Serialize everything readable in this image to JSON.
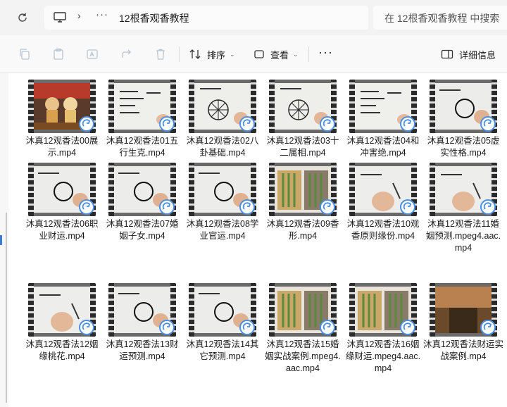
{
  "address": {
    "breadcrumb": "12根香观香教程",
    "search_placeholder": "在 12根香观香教程 中搜索"
  },
  "toolbar": {
    "sort_label": "排序",
    "view_label": "查看",
    "more_label": "···",
    "details_label": "详细信息"
  },
  "colors": {
    "accent": "#4b8fe2",
    "toolbar_bg": "#f9f9f9",
    "address_bg": "#f3f3f3"
  },
  "files": [
    {
      "name": "沐真12观香法00展示.mp4",
      "thumb": "altar"
    },
    {
      "name": "沐真12观香法01五行生克.mp4",
      "thumb": "writing"
    },
    {
      "name": "沐真12观香法02八卦基础.mp4",
      "thumb": "bagua"
    },
    {
      "name": "沐真12观香法03十二属相.mp4",
      "thumb": "bagua"
    },
    {
      "name": "沐真12观香法04和冲害绝.mp4",
      "thumb": "writing"
    },
    {
      "name": "沐真12观香法05虚实性格.mp4",
      "thumb": "circle"
    },
    {
      "name": "沐真12观香法06职业财运.mp4",
      "thumb": "circle"
    },
    {
      "name": "沐真12观香法07婚姻子女.mp4",
      "thumb": "circle"
    },
    {
      "name": "沐真12观香法08学业官运.mp4",
      "thumb": "circle"
    },
    {
      "name": "沐真12观香法09香形.mp4",
      "thumb": "incense"
    },
    {
      "name": "沐真12观香法10观香原则缘份.mp4",
      "thumb": "hand"
    },
    {
      "name": "沐真12观香法11婚姻预测.mpeg4.aac.mp4",
      "thumb": "hand"
    },
    {
      "name": "沐真12观香法12姻缘桃花.mp4",
      "thumb": "hand"
    },
    {
      "name": "沐真12观香法13财运预测.mp4",
      "thumb": "circle"
    },
    {
      "name": "沐真12观香法14其它预测.mp4",
      "thumb": "circle"
    },
    {
      "name": "沐真12观香法15婚姻实战案例.mpeg4.aac.mp4",
      "thumb": "incense"
    },
    {
      "name": "沐真12观香法16姻缘财运.mpeg4.aac.mp4",
      "thumb": "incense"
    },
    {
      "name": "沐真12观香法财运实战案例.mp4",
      "thumb": "room"
    }
  ]
}
